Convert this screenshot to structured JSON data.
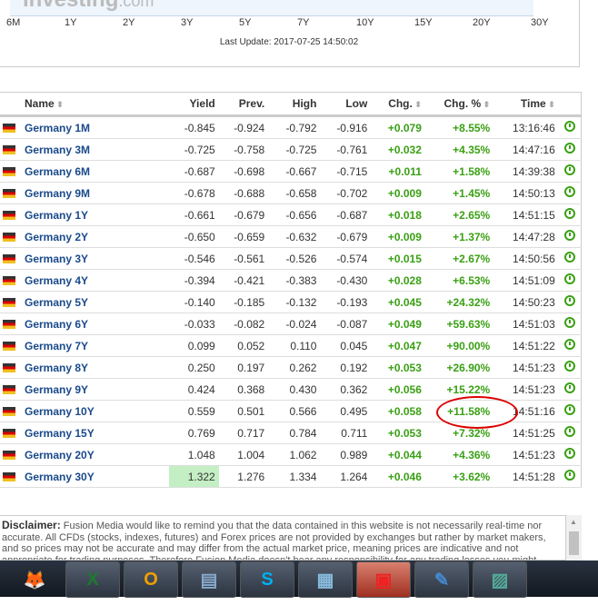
{
  "chart": {
    "logo": "Investing",
    "logo_suffix": ".com",
    "x_ticks": [
      "6M",
      "1Y",
      "2Y",
      "3Y",
      "5Y",
      "7Y",
      "10Y",
      "15Y",
      "20Y",
      "30Y"
    ],
    "last_update": "Last Update: 2017-07-25 14:50:02"
  },
  "table": {
    "headers": [
      "Name",
      "Yield",
      "Prev.",
      "High",
      "Low",
      "Chg.",
      "Chg. %",
      "Time"
    ],
    "rows": [
      [
        "Germany 1M",
        "-0.845",
        "-0.924",
        "-0.792",
        "-0.916",
        "+0.079",
        "+8.55%",
        "13:16:46"
      ],
      [
        "Germany 3M",
        "-0.725",
        "-0.758",
        "-0.725",
        "-0.761",
        "+0.032",
        "+4.35%",
        "14:47:16"
      ],
      [
        "Germany 6M",
        "-0.687",
        "-0.698",
        "-0.667",
        "-0.715",
        "+0.011",
        "+1.58%",
        "14:39:38"
      ],
      [
        "Germany 9M",
        "-0.678",
        "-0.688",
        "-0.658",
        "-0.702",
        "+0.009",
        "+1.45%",
        "14:50:13"
      ],
      [
        "Germany 1Y",
        "-0.661",
        "-0.679",
        "-0.656",
        "-0.687",
        "+0.018",
        "+2.65%",
        "14:51:15"
      ],
      [
        "Germany 2Y",
        "-0.650",
        "-0.659",
        "-0.632",
        "-0.679",
        "+0.009",
        "+1.37%",
        "14:47:28"
      ],
      [
        "Germany 3Y",
        "-0.546",
        "-0.561",
        "-0.526",
        "-0.574",
        "+0.015",
        "+2.67%",
        "14:50:56"
      ],
      [
        "Germany 4Y",
        "-0.394",
        "-0.421",
        "-0.383",
        "-0.430",
        "+0.028",
        "+6.53%",
        "14:51:09"
      ],
      [
        "Germany 5Y",
        "-0.140",
        "-0.185",
        "-0.132",
        "-0.193",
        "+0.045",
        "+24.32%",
        "14:50:23"
      ],
      [
        "Germany 6Y",
        "-0.033",
        "-0.082",
        "-0.024",
        "-0.087",
        "+0.049",
        "+59.63%",
        "14:51:03"
      ],
      [
        "Germany 7Y",
        "0.099",
        "0.052",
        "0.110",
        "0.045",
        "+0.047",
        "+90.00%",
        "14:51:22"
      ],
      [
        "Germany 8Y",
        "0.250",
        "0.197",
        "0.262",
        "0.192",
        "+0.053",
        "+26.90%",
        "14:51:23"
      ],
      [
        "Germany 9Y",
        "0.424",
        "0.368",
        "0.430",
        "0.362",
        "+0.056",
        "+15.22%",
        "14:51:23"
      ],
      [
        "Germany 10Y",
        "0.559",
        "0.501",
        "0.566",
        "0.495",
        "+0.058",
        "+11.58%",
        "14:51:16"
      ],
      [
        "Germany 15Y",
        "0.769",
        "0.717",
        "0.784",
        "0.711",
        "+0.053",
        "+7.32%",
        "14:51:25"
      ],
      [
        "Germany 20Y",
        "1.048",
        "1.004",
        "1.062",
        "0.989",
        "+0.044",
        "+4.36%",
        "14:51:23"
      ],
      [
        "Germany 30Y",
        "1.322",
        "1.276",
        "1.334",
        "1.264",
        "+0.046",
        "+3.62%",
        "14:51:28"
      ]
    ],
    "highlight_color": "#c4efc4",
    "positive_color": "#3aa014"
  },
  "disclaimer": {
    "label": "Disclaimer:",
    "text": " Fusion Media would like to remind you that the data contained in this website is not necessarily real-time nor accurate. All CFDs (stocks, indexes, futures) and Forex prices are not provided by exchanges but rather by market makers, and so prices may not be accurate and may differ from the actual market price, meaning prices are indicative and not appropriate for trading purposes. Therefore Fusion Media doesn't bear any responsibility for any trading losses you might"
  },
  "taskbar": [
    "firefox-icon",
    "excel-icon",
    "outlook-icon",
    "notepad-icon",
    "skype-icon",
    "calculator-icon",
    "remote-desktop-icon",
    "paint-icon",
    "photo-viewer-icon"
  ]
}
